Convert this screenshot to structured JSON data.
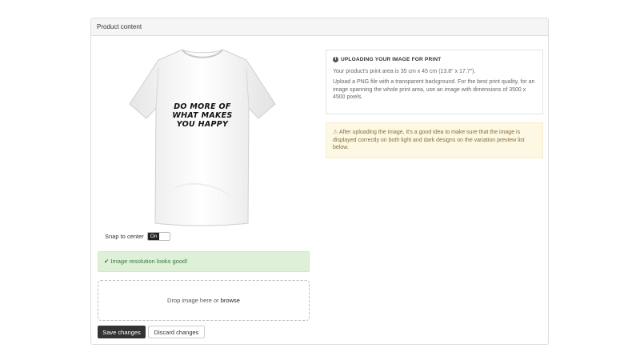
{
  "panel": {
    "title": "Product content"
  },
  "preview": {
    "print_lines": [
      "DO MORE OF",
      "WHAT MAKES",
      "YOU HAPPY"
    ]
  },
  "snap": {
    "label": "Snap to center",
    "toggle_label": "On"
  },
  "status": {
    "message": "Image resolution looks good!",
    "icon": "check-icon"
  },
  "dropzone": {
    "text": "Drop image here or ",
    "browse": "browse"
  },
  "buttons": {
    "save": "Save changes",
    "discard": "Discard changes"
  },
  "info": {
    "title": "Uploading your image for print",
    "icon": "info-icon",
    "print_area": "Your product's print area is 35 cm x 45 cm (13.8\" x 17.7\").",
    "instructions": "Upload a PNG file with a transparent background. For the best print quality, for an image spanning the whole print area, use an image with dimensions of 3500 x 4500 pixels."
  },
  "warning": {
    "icon": "warning-icon",
    "text": "After uploading the image, it's a good idea to make sure that the image is displayed correctly on both light and dark designs on the variation preview list below."
  },
  "colors": {
    "success_bg": "#dff0d8",
    "success_text": "#3c763d",
    "warning_bg": "#fcf8e3",
    "warning_text": "#8a6d3b",
    "primary_button": "#333333"
  }
}
